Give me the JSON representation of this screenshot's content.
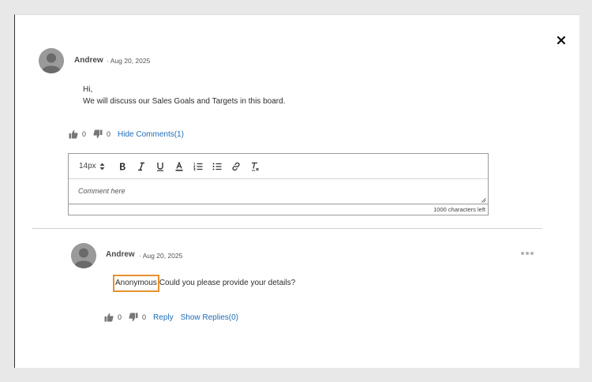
{
  "post": {
    "author": "Andrew",
    "date": "Aug 20, 2025",
    "separator": "·",
    "greeting": "Hi,",
    "message": "We will discuss our Sales Goals and Targets in this board.",
    "likes": "0",
    "dislikes": "0",
    "hide_comments_label": "Hide Comments(1)"
  },
  "editor": {
    "font_size": "14px",
    "placeholder": "Comment here",
    "chars_left": "1000 characters left"
  },
  "comment": {
    "author": "Andrew",
    "date": "Aug 20, 2025",
    "separator": "·",
    "mention": "Anonymous",
    "text": "Could you please provide your details?",
    "likes": "0",
    "dislikes": "0",
    "reply_label": "Reply",
    "show_replies_label": "Show Replies(0)"
  },
  "colors": {
    "link": "#1f6db5",
    "highlight": "#e8912d",
    "avatar": "#8f8f8f"
  }
}
